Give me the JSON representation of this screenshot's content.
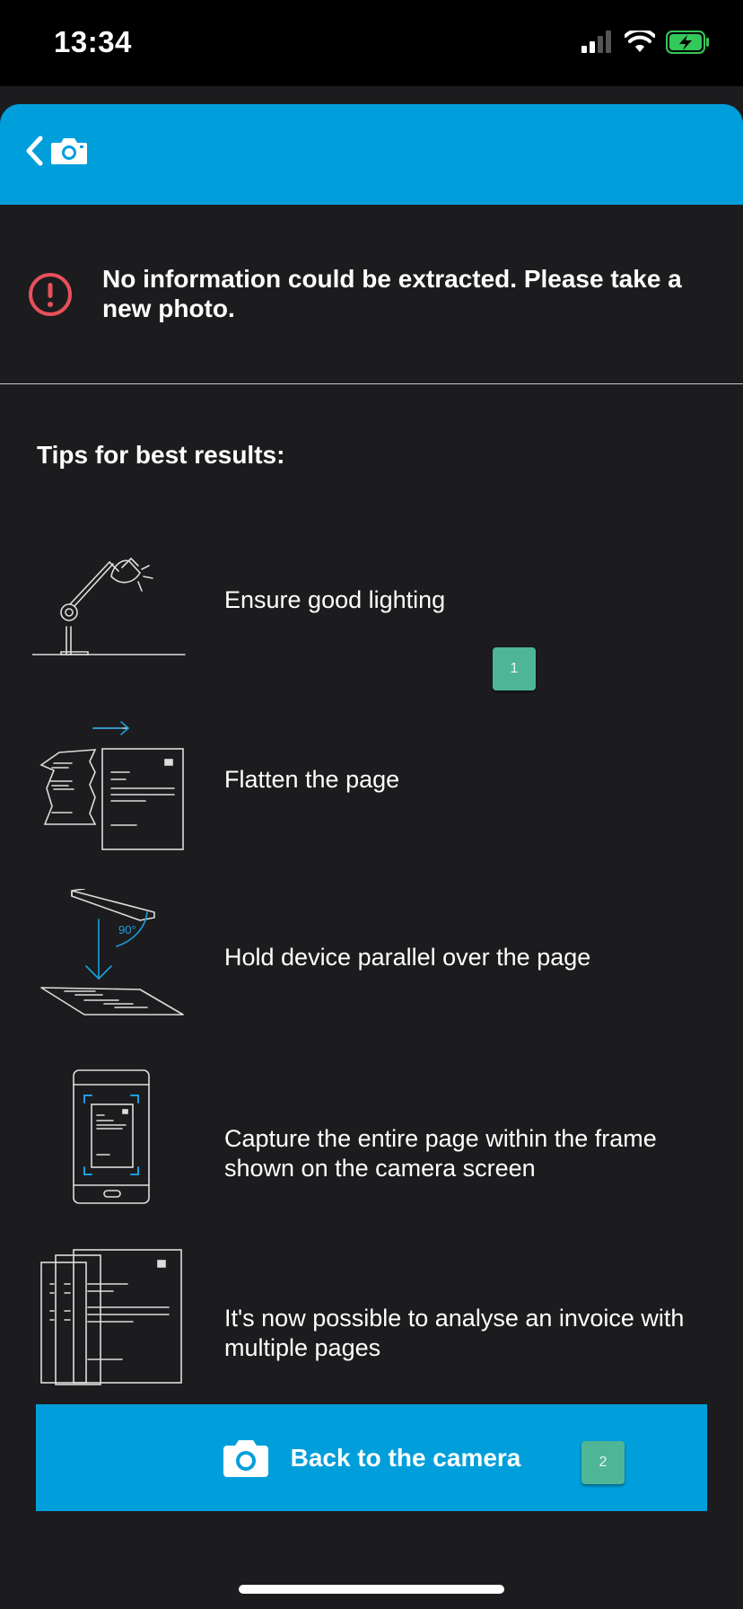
{
  "status_bar": {
    "time": "13:34"
  },
  "error": {
    "message": "No information could be extracted. Please take a new photo."
  },
  "tips": {
    "title": "Tips for best results:",
    "items": [
      {
        "text": "Ensure good lighting",
        "icon": "lamp-icon"
      },
      {
        "text": "Flatten the page",
        "icon": "flatten-page-icon"
      },
      {
        "text": "Hold device parallel over the page",
        "icon": "parallel-device-icon",
        "angle_label": "90°"
      },
      {
        "text": "Capture the entire page within the frame shown on the camera screen",
        "icon": "phone-frame-icon"
      },
      {
        "text": "It's now possible to analyse an invoice with multiple pages",
        "icon": "multiple-pages-icon"
      }
    ]
  },
  "action": {
    "label": "Back to the camera"
  },
  "badges": [
    "1",
    "2"
  ],
  "colors": {
    "accent": "#009fdb",
    "background": "#1c1c1e",
    "error": "#e8505b",
    "badge": "#4fb597",
    "battery": "#34c759"
  }
}
